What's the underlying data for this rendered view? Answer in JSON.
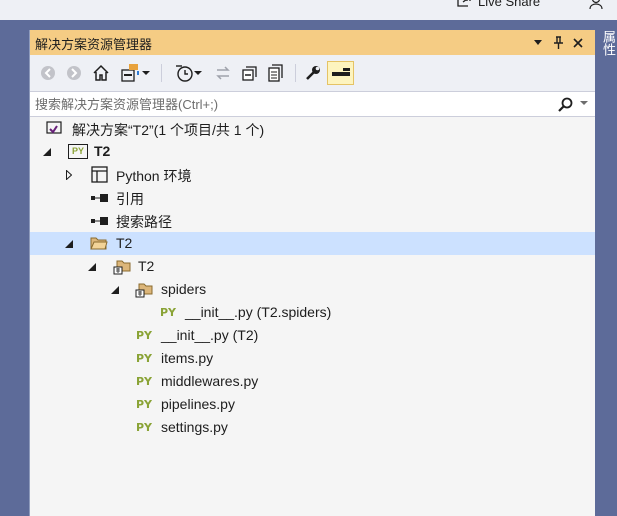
{
  "app": {
    "live_share_label": "Live Share",
    "right_tab_label": "属性"
  },
  "panel": {
    "title": "解决方案资源管理器",
    "title_buttons": [
      "dropdown-icon",
      "pin-icon",
      "close-icon"
    ],
    "toolbar_icons": [
      "back-icon",
      "forward-icon",
      "home-icon",
      "switch-views-icon",
      "pending-changes-icon",
      "sync-icon",
      "collapse-all-icon",
      "show-all-files-icon",
      "properties-icon",
      "preview-icon"
    ]
  },
  "search": {
    "placeholder": "搜索解决方案资源管理器(Ctrl+;)"
  },
  "tree": {
    "solution": "解决方案“T2”(1 个项目/共 1 个)",
    "project": "T2",
    "python_env": "Python 环境",
    "references": "引用",
    "search_paths": "搜索路径",
    "folder_t2": "T2",
    "package_t2": "T2",
    "spiders": "spiders",
    "spiders_init": "__init__.py (T2.spiders)",
    "init": "__init__.py (T2)",
    "items": "items.py",
    "middlewares": "middlewares.py",
    "pipelines": "pipelines.py",
    "settings": "settings.py",
    "py_badge": "PY"
  },
  "colors": {
    "title_bar": "#f5cc84",
    "selection": "#cce1ff",
    "python_green": "#8aa336",
    "frame": "#5d6b99"
  }
}
